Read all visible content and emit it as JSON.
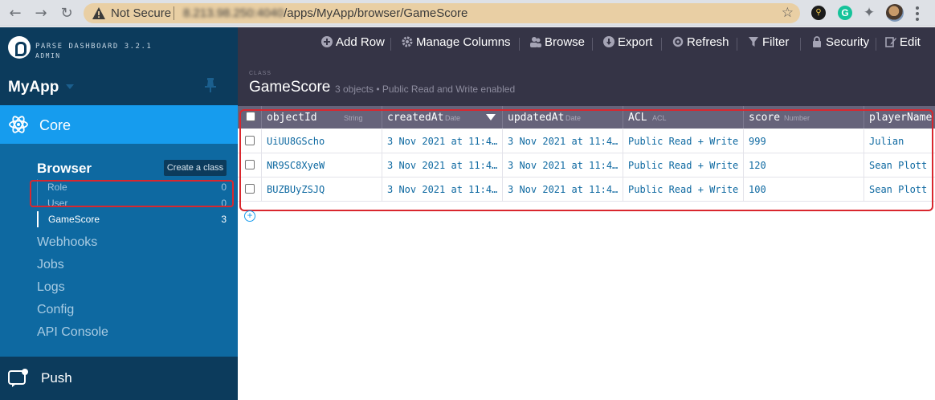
{
  "browser": {
    "security_label": "Not Secure",
    "url_host": "8.213.98.250:4040",
    "url_path": "/apps/MyApp/browser/GameScore"
  },
  "sidebar": {
    "brand_title": "PARSE DASHBOARD 3.2.1",
    "brand_sub": "ADMIN",
    "app_name": "MyApp",
    "core_label": "Core",
    "browser_title": "Browser",
    "create_class_label": "Create a class",
    "classes": [
      {
        "label": "Role",
        "count": "0"
      },
      {
        "label": "User",
        "count": "0"
      },
      {
        "label": "GameScore",
        "count": "3"
      }
    ],
    "nav_items": [
      "Webhooks",
      "Jobs",
      "Logs",
      "Config",
      "API Console"
    ],
    "push_label": "Push"
  },
  "toolbar": {
    "add_row": "Add Row",
    "manage_columns": "Manage Columns",
    "browse": "Browse",
    "export": "Export",
    "refresh": "Refresh",
    "filter": "Filter",
    "security": "Security",
    "edit": "Edit"
  },
  "header": {
    "caption": "CLASS",
    "class_name": "GameScore",
    "subtitle": "3 objects • Public Read and Write enabled"
  },
  "table": {
    "columns": [
      {
        "name": "objectId",
        "type": "String"
      },
      {
        "name": "createdAt",
        "type": "Date"
      },
      {
        "name": "updatedAt",
        "type": "Date"
      },
      {
        "name": "ACL",
        "type": "ACL"
      },
      {
        "name": "score",
        "type": "Number"
      },
      {
        "name": "playerName",
        "type": ""
      }
    ],
    "rows": [
      [
        "UiUU8GScho",
        "3 Nov 2021 at 11:4…",
        "3 Nov 2021 at 11:4…",
        "Public Read + Write",
        "999",
        "Julian"
      ],
      [
        "NR9SC8XyeW",
        "3 Nov 2021 at 11:4…",
        "3 Nov 2021 at 11:4…",
        "Public Read + Write",
        "120",
        "Sean Plott"
      ],
      [
        "BUZBUyZSJQ",
        "3 Nov 2021 at 11:4…",
        "3 Nov 2021 at 11:4…",
        "Public Read + Write",
        "100",
        "Sean Plott"
      ]
    ]
  },
  "colors": {
    "accent": "#169cee",
    "sidebar": "#0e69a1",
    "sidebar_dark": "#0c3b5c",
    "toolbar": "#353446",
    "header_row": "#66637a",
    "highlight": "#d9272e"
  }
}
